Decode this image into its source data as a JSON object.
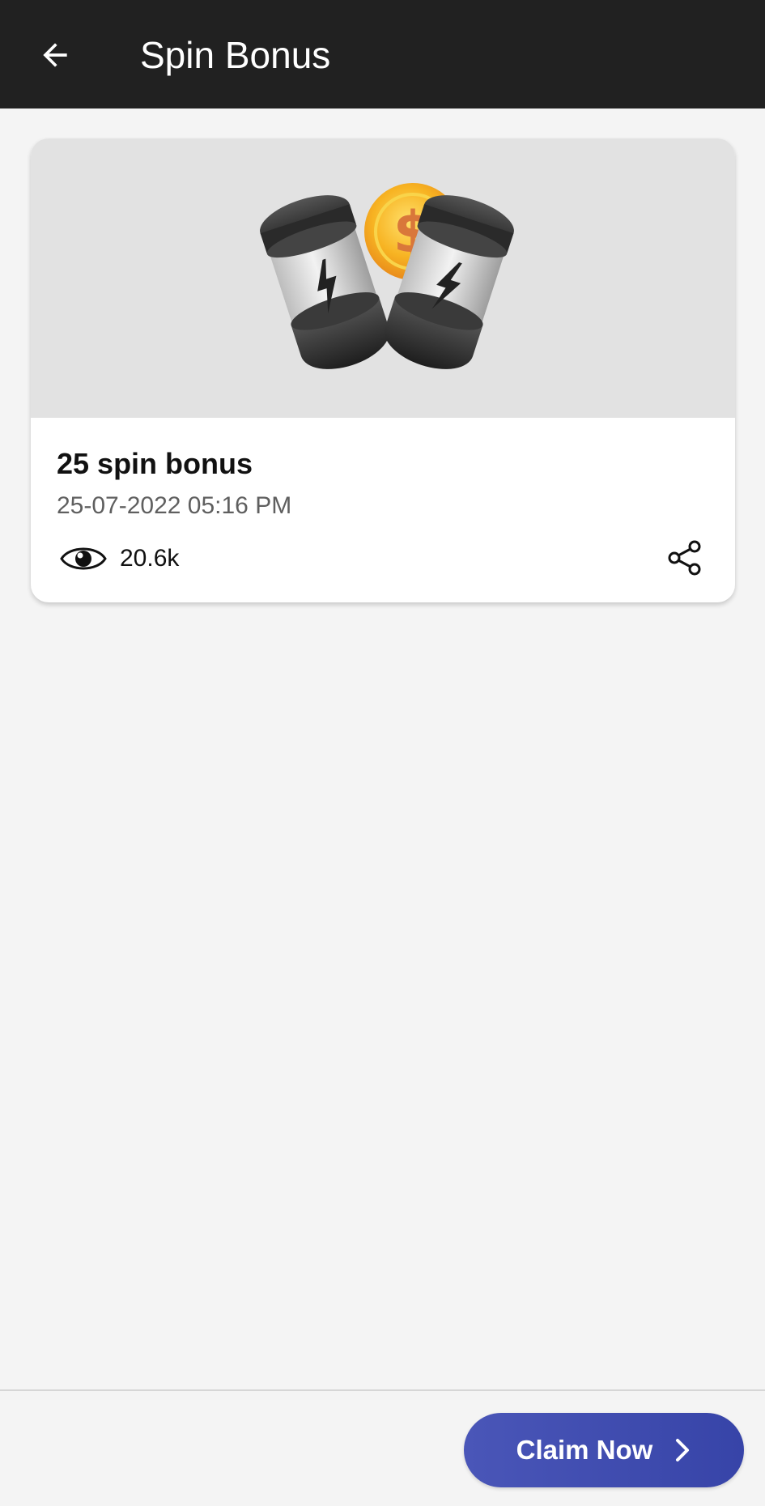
{
  "header": {
    "title": "Spin Bonus",
    "back_icon": "arrow-left-icon",
    "background": "#212121"
  },
  "card": {
    "image": "battery-coin-illustration",
    "title": "25 spin bonus",
    "date": "25-07-2022 05:16 PM",
    "views": "20.6k",
    "views_icon": "eye-icon",
    "share_icon": "share-icon"
  },
  "footer": {
    "claim_label": "Claim Now",
    "claim_icon": "chevron-right-icon",
    "accent": "#3f4db0"
  }
}
